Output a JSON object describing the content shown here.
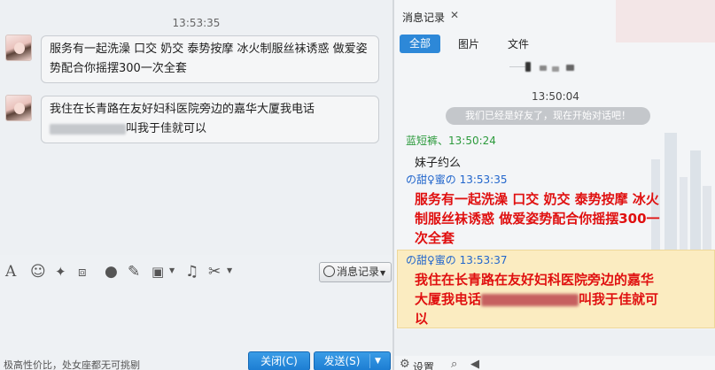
{
  "chat": {
    "timestamp": "13:53:35",
    "messages": [
      {
        "text": "服务有一起洗澡 口交 奶交 泰势按摩 冰火制服丝袜诱惑 做爱姿势配合你摇摆300一次全套"
      },
      {
        "line1": "我住在长青路在友好妇科医院旁边的嘉华大厦我电话",
        "line2_suffix": "叫我于佳就可以"
      }
    ]
  },
  "toolbar": {
    "icons": [
      "font-icon",
      "emoji-icon",
      "magic-icon",
      "screenshot-icon",
      "microphone-icon",
      "edit-icon",
      "image-icon",
      "music-icon",
      "scissors-icon"
    ],
    "history_button_label": "消息记录"
  },
  "footer": {
    "hint": "极高性价比，处女座都无可挑剔",
    "close_label": "关闭(C)",
    "send_label": "发送(S)"
  },
  "history": {
    "tab_label": "消息记录",
    "filters": {
      "all": "全部",
      "images": "图片",
      "files": "文件"
    },
    "timestamp": "13:50:04",
    "friend_notice": "我们已经是好友了，现在开始对话吧！",
    "entries": [
      {
        "sender": "蓝短裤、13:50:24",
        "text": "妹子约么"
      },
      {
        "sender": "の甜♀蜜の 13:53:35",
        "text_lines": [
          "服务有一起洗澡 口交 奶交 泰势按摩 冰火",
          "制服丝袜诱惑 做爱姿势配合你摇摆300一",
          "次全套"
        ]
      },
      {
        "sender": "の甜♀蜜の 13:53:37",
        "text_line1": "我住在长青路在友好妇科医院旁边的嘉华",
        "text_line2_prefix": "大厦我电话",
        "text_line2_suffix": "叫我于佳就可",
        "text_line3": "以"
      }
    ],
    "settings_label": "设置"
  },
  "colors": {
    "accent_blue": "#2d88d8",
    "red_text": "#e01010",
    "green_sender": "#2c9a3c",
    "blue_sender": "#2266cc",
    "highlight": "#fbecc1"
  }
}
